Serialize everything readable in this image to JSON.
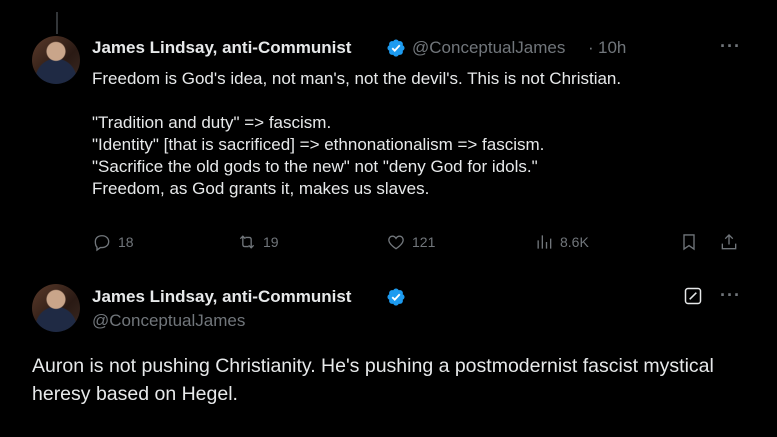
{
  "reply_tweet": {
    "author_name": "James Lindsay, anti-Communist",
    "handle": "@ConceptualJames",
    "separator": "·",
    "time": "10h",
    "more": "···",
    "lines": [
      "Freedom is God's idea, not man's, not the devil's. This is not Christian.",
      "",
      "\"Tradition and duty\" => fascism.",
      "\"Identity\" [that is sacrificed] => ethnonationalism => fascism.",
      "\"Sacrifice the old gods to the new\" not \"deny God for idols.\"",
      "Freedom, as God grants it, makes us slaves."
    ],
    "stats": {
      "replies": "18",
      "reposts": "19",
      "likes": "121",
      "views": "8.6K"
    }
  },
  "main_tweet": {
    "author_name": "James Lindsay, anti-Communist",
    "handle": "@ConceptualJames",
    "more": "···",
    "text": "Auron is not pushing Christianity. He's pushing a postmodernist fascist mystical heresy based on Hegel."
  },
  "icons": [
    "verified-badge-icon",
    "reply-icon",
    "repost-icon",
    "like-icon",
    "views-icon",
    "bookmark-icon",
    "share-icon",
    "edit-icon",
    "more-icon"
  ],
  "colors": {
    "background": "#000000",
    "text": "#e7e9ea",
    "muted": "#71767b",
    "verified": "#1d9bf0"
  }
}
